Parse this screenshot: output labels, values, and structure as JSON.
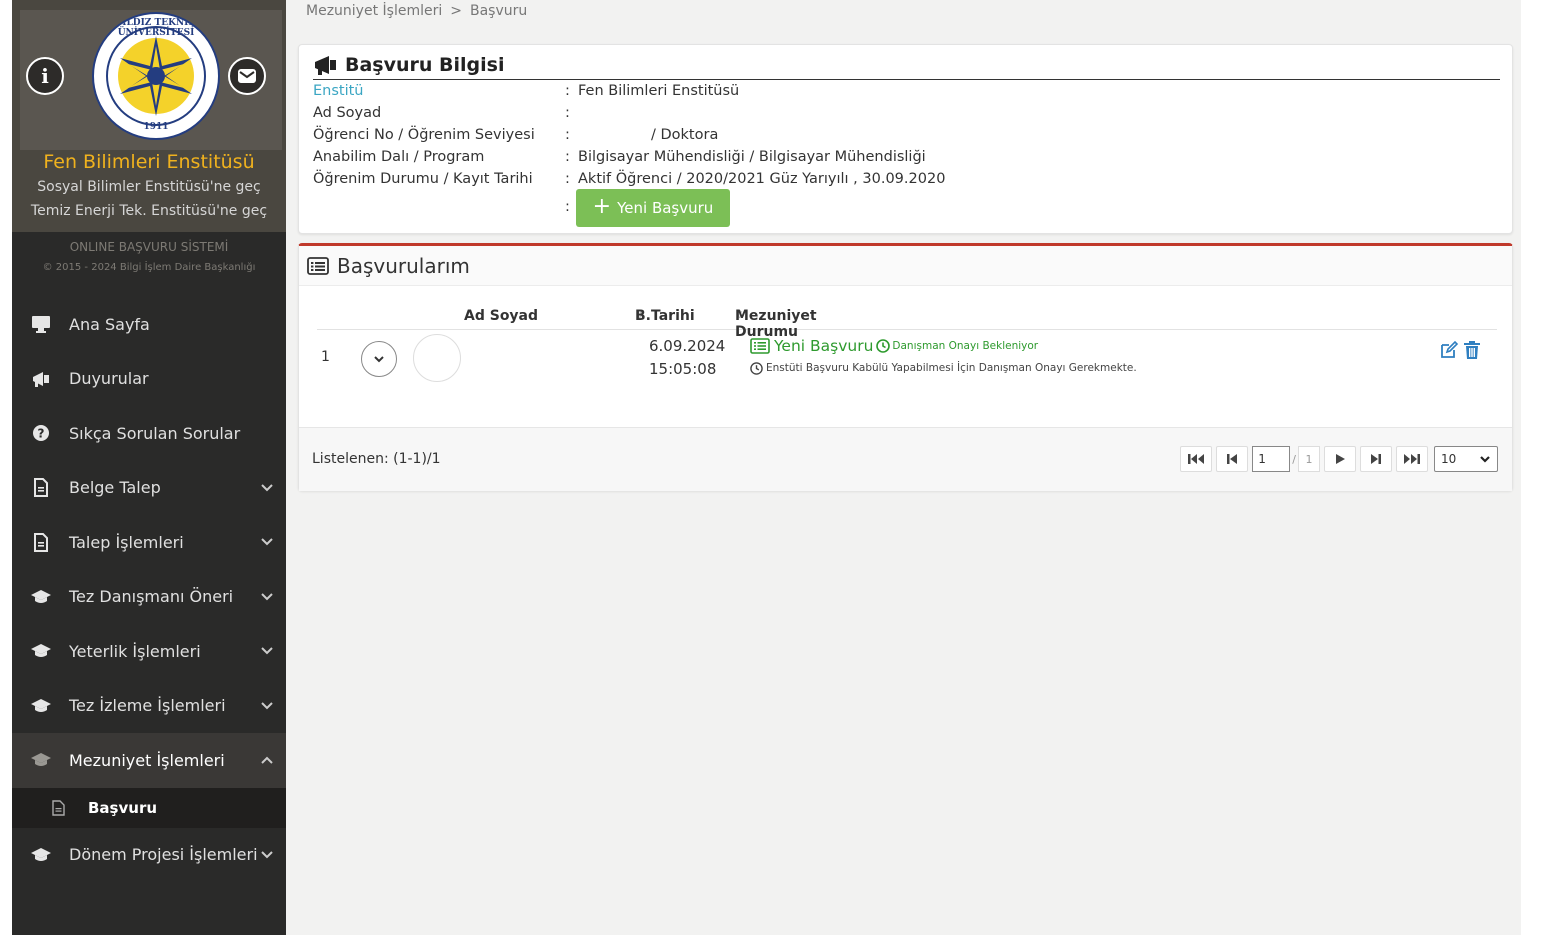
{
  "sidebar": {
    "seal_top_text": "YILDIZ TEKNİK ÜNİVERSİTESİ",
    "seal_year": "1911",
    "institute_name": "Fen Bilimleri Enstitüsü",
    "switch_links": [
      "Sosyal Bilimler Enstitüsü'ne geç",
      "Temiz Enerji Tek. Enstitüsü'ne geç"
    ],
    "system_name": "ONLINE BAŞVURU SİSTEMİ",
    "copyright": "© 2015 - 2024 Bilgi İşlem Daire Başkanlığı",
    "menu": [
      {
        "label": "Ana Sayfa",
        "icon": "desktop-icon"
      },
      {
        "label": "Duyurular",
        "icon": "bullhorn-icon"
      },
      {
        "label": "Sıkça Sorulan Sorular",
        "icon": "question-circle-icon"
      },
      {
        "label": "Belge Talep",
        "icon": "file-icon"
      },
      {
        "label": "Talep İşlemleri",
        "icon": "file-icon"
      },
      {
        "label": "Tez Danışmanı Öneri",
        "icon": "graduation-cap-icon"
      },
      {
        "label": "Yeterlik İşlemleri",
        "icon": "graduation-cap-icon"
      },
      {
        "label": "Tez İzleme İşlemleri",
        "icon": "graduation-cap-icon"
      },
      {
        "label": "Mezuniyet İşlemleri",
        "icon": "graduation-cap-icon"
      },
      {
        "label": "Dönem Projesi İşlemleri",
        "icon": "graduation-cap-icon"
      }
    ],
    "submenu": [
      {
        "label": "Başvuru",
        "icon": "file-outline-icon"
      }
    ]
  },
  "breadcrumb": {
    "items": [
      "Mezuniyet İşlemleri",
      "Başvuru"
    ],
    "separator": ">"
  },
  "info_panel": {
    "title": "Başvuru Bilgisi",
    "rows": [
      {
        "label": "Enstitü",
        "value": "Fen Bilimleri Enstitüsü"
      },
      {
        "label": "Ad Soyad",
        "value": ""
      },
      {
        "label": "Öğrenci No / Öğrenim Seviyesi",
        "value": "/ Doktora"
      },
      {
        "label": "Anabilim Dalı / Program",
        "value": "Bilgisayar Mühendisliği / Bilgisayar Mühendisliği"
      },
      {
        "label": "Öğrenim Durumu / Kayıt Tarihi",
        "value": "Aktif Öğrenci / 2020/2021 Güz Yarıyılı , 30.09.2020"
      }
    ],
    "colon": ":",
    "new_button_label": "Yeni Başvuru"
  },
  "list_panel": {
    "title": "Başvurularım",
    "columns": [
      "Ad Soyad",
      "B.Tarihi",
      "Mezuniyet Durumu"
    ],
    "rows": [
      {
        "num": "1",
        "date": "6.09.2024",
        "time": "15:05:08",
        "status_title": "Yeni Başvuru",
        "status_note": "Danışman Onayı Bekleniyor",
        "status_detail": "Enstüti Başvuru Kabülü Yapabilmesi İçin Danışman Onayı Gerekmekte."
      }
    ],
    "footer_count": "Listelenen: (1-1)/1",
    "pager": {
      "page": "1",
      "slash": "/",
      "total": "1",
      "page_size": "10"
    }
  },
  "colors": {
    "sidebar_bg": "#2a2a29",
    "brand_bg": "#4a4740",
    "institute_gold": "#f0b21e",
    "success_green": "#7cbf56",
    "status_green": "#2e9a2e",
    "accent_red": "#c0392b",
    "link_blue": "#2f7fc0"
  }
}
